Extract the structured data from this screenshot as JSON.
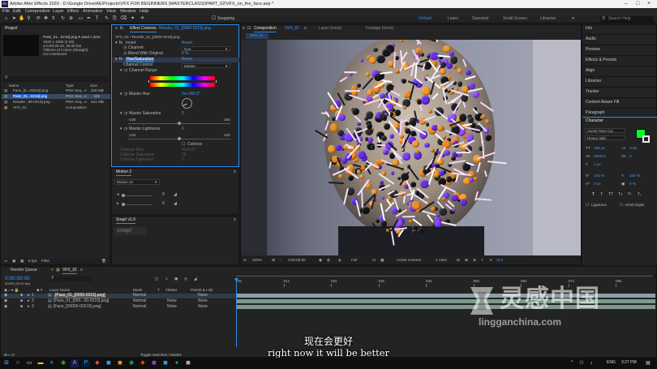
{
  "window": {
    "title": "Adobe After Effects 2020 - D:\\Google Drive\\AE\\Projects\\VFX FOR BEGINNERS (MASTERCLASS)\\PART_02\\VFX_on_the_face.aep *",
    "app_badge": "Ae"
  },
  "menu": [
    "File",
    "Edit",
    "Composition",
    "Layer",
    "Effect",
    "Animation",
    "View",
    "Window",
    "Help"
  ],
  "toolbar": {
    "snapping": "Snapping",
    "workspaces": [
      "Default",
      "Learn",
      "Standard",
      "Small Screen",
      "Libraries"
    ],
    "active_workspace": "Default",
    "search_placeholder": "Search Help"
  },
  "project": {
    "tab": "Project",
    "selected_info": [
      "Pass_01...0215].png ▾ used 1 time",
      "1920 x 1080 (1.00)",
      "Δ 0:00:00:16, 25.00 fps",
      "Trillions of Colors (Straight)",
      "non-interlaced"
    ],
    "columns": [
      "Name",
      "Type",
      "Size"
    ],
    "items": [
      {
        "name": "Face_[0...00215].png",
        "type": "PNG Seq...e",
        "size": "345 MB"
      },
      {
        "name": "Pass_01...0215].png",
        "type": "PNG Seq...e",
        "size": "MB",
        "selected": true
      },
      {
        "name": "Render...89-0215].png",
        "type": "PNG Seq...e",
        "size": "541 MB"
      },
      {
        "name": "VFX_01",
        "type": "Composition",
        "size": ""
      }
    ],
    "footer": {
      "bpc": "8 bpc",
      "filter": "Filter"
    }
  },
  "effect_controls": {
    "tab": "Effect Controls",
    "tab_target": "Render_01_[0000-0215].png",
    "header": "VFX_01 • Render_01_[0000-0215].png",
    "effects": [
      {
        "name": "Invert",
        "reset": "Reset"
      },
      {
        "name": "Channel",
        "value": "Hue"
      },
      {
        "name": "Blend With Original",
        "value": "0 %"
      },
      {
        "name": "Hue/Saturation",
        "reset": "Reset"
      }
    ],
    "channel_control_label": "Channel Control",
    "channel_control_value": "Master",
    "channel_range_label": "Channel Range",
    "master_hue_label": "Master Hue",
    "master_hue_value": "0x+245.0°",
    "master_saturation_label": "Master Saturation",
    "master_saturation_value": "0",
    "master_saturation_min": "-100",
    "master_saturation_max": "100",
    "master_lightness_label": "Master Lightness",
    "master_lightness_value": "0",
    "master_lightness_min": "-100",
    "master_lightness_max": "100",
    "colorize_label": "Colorize",
    "dimmed": [
      {
        "label": "Colorize Hue",
        "value": "0x+0.0°"
      },
      {
        "label": "Colorize Saturation",
        "value": "25"
      },
      {
        "label": "Colorize Lightness",
        "value": "0"
      }
    ]
  },
  "motion": {
    "tab": "Motion 2",
    "dropdown": "Motion v2",
    "value_a": "0",
    "value_b": "0"
  },
  "snap": {
    "tab": "Snap! v1.0",
    "logo_text": "snap!"
  },
  "composition": {
    "tab": "Composition",
    "tab_target": "VFX_01",
    "other_tabs": [
      "Layer (none)",
      "Footage (none)"
    ],
    "breadcrumb": "VFX_01",
    "footer": {
      "zoom": "100%",
      "timecode": "0:00:00:00",
      "resolution": "Full",
      "camera": "Active Camera",
      "views": "1 View",
      "offset": "+0.0"
    }
  },
  "right_panels": [
    "Info",
    "Audio",
    "Preview",
    "Effects & Presets",
    "Align",
    "Libraries",
    "Tracker",
    "Content-Aware Fill",
    "Paragraph"
  ],
  "character": {
    "title": "Character",
    "font": "Avenir Next Cyr",
    "style": "Heavy Italic",
    "size": "186 px",
    "leading": "Auto",
    "kerning": "Metrics",
    "tracking": "0",
    "stroke": "1 px",
    "vert_scale": "100 %",
    "horiz_scale": "100 %",
    "baseline": "0 px",
    "tsume": "0 %",
    "fill_color": "#00ff24",
    "options": [
      "Ligatures",
      "Hindi Digits"
    ]
  },
  "timeline": {
    "tabs": [
      "Render Queue",
      "VFX_01"
    ],
    "timecode": "0:00:00:00",
    "frame_info": "00000 (25.00 fps)",
    "columns": [
      "Layer Name",
      "Mode",
      "T",
      "TrkMat",
      "Parent & Link"
    ],
    "layers": [
      {
        "num": "1",
        "name": "[Pass_01_[0000-0215].png]",
        "mode": "Normal",
        "trk": "",
        "parent": "None"
      },
      {
        "num": "2",
        "name": "[Pass_01_[000...00-0215].png]",
        "mode": "Normal",
        "trk": "None",
        "parent": "None"
      },
      {
        "num": "3",
        "name": "[Face_[00000-00215].png]",
        "mode": "Normal",
        "trk": "None",
        "parent": "None"
      }
    ],
    "ruler": [
      "0s",
      "01s",
      "02s",
      "03s",
      "04s",
      "05s",
      "06s",
      "07s",
      "08s"
    ],
    "toggle": "Toggle Switches / Modes"
  },
  "subtitles": {
    "cn": "现在会更好",
    "en": "right now it will be better"
  },
  "watermark": {
    "cn": "灵感中国",
    "url": "lingganchina.com"
  },
  "taskbar": {
    "lang": "ENG",
    "time": "3:27 PM"
  }
}
